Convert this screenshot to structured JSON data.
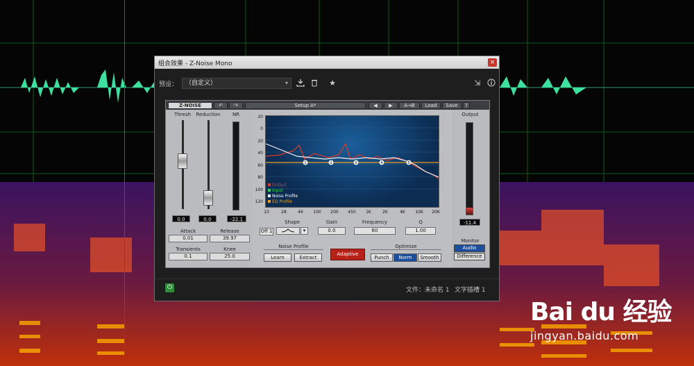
{
  "dialog": {
    "title": "组合效果 - Z-Noise Mono",
    "close_glyph": "×",
    "preset_label": "预设：",
    "preset_value": "（自定义）"
  },
  "plugin": {
    "logo": "Z-NOISE",
    "undo": "↶",
    "redo": "↷",
    "setup": "Setup A*",
    "prev": "◀",
    "next": "▶",
    "ab": "A→B",
    "load": "Load",
    "save": "Save",
    "help": "?"
  },
  "left": {
    "labels": [
      "Thresh",
      "Reduction",
      "NR"
    ],
    "values": [
      "0.0",
      "0.0",
      "-22.1"
    ],
    "attack_label": "Attack",
    "attack_value": "0.01",
    "release_label": "Release",
    "release_value": "39.97",
    "transients_label": "Transients",
    "transients_value": "0.1",
    "knee_label": "Knee",
    "knee_value": "25.0"
  },
  "graph": {
    "y_ticks": [
      "20",
      "0",
      "20",
      "40",
      "60",
      "80",
      "100",
      "120"
    ],
    "x_ticks": [
      "10",
      "28",
      "46",
      "100",
      "200",
      "450",
      "1K",
      "2K",
      "4K",
      "10K",
      "20K"
    ],
    "legend": [
      {
        "name": "Output",
        "color": "#e03a2a"
      },
      {
        "name": "Input",
        "color": "#2fd04a"
      },
      {
        "name": "Noise Profile",
        "color": "#ffffff"
      },
      {
        "name": "EQ Profile",
        "color": "#f0a020"
      }
    ],
    "bands": [
      "1",
      "2",
      "3",
      "4",
      "5"
    ]
  },
  "controls": {
    "off_label": "Off 1",
    "shape_label": "Shape",
    "gain_label": "Gain",
    "gain_value": "0.0",
    "freq_label": "Frequency",
    "freq_value": "60",
    "q_label": "Q",
    "q_value": "1.00",
    "noise_profile_label": "Noise Profile",
    "learn": "Learn",
    "extract": "Extract",
    "adaptive": "Adaptive",
    "optimize_label": "Optimize",
    "punch": "Punch",
    "norm": "Norm",
    "smooth": "Smooth"
  },
  "right": {
    "output_label": "Output",
    "output_value": "-11.4",
    "monitor_label": "Monitor",
    "audio": "Audio",
    "difference": "Difference"
  },
  "status": {
    "file": "文件：未命名 1",
    "slot": "文字插槽 1"
  },
  "watermark": {
    "brand": "Bai du 经验",
    "url": "jingyan.baidu.com"
  },
  "colors": {
    "waveform": "#3ee0a0",
    "adaptive": "#b6221a",
    "norm": "#1b4e9e"
  }
}
